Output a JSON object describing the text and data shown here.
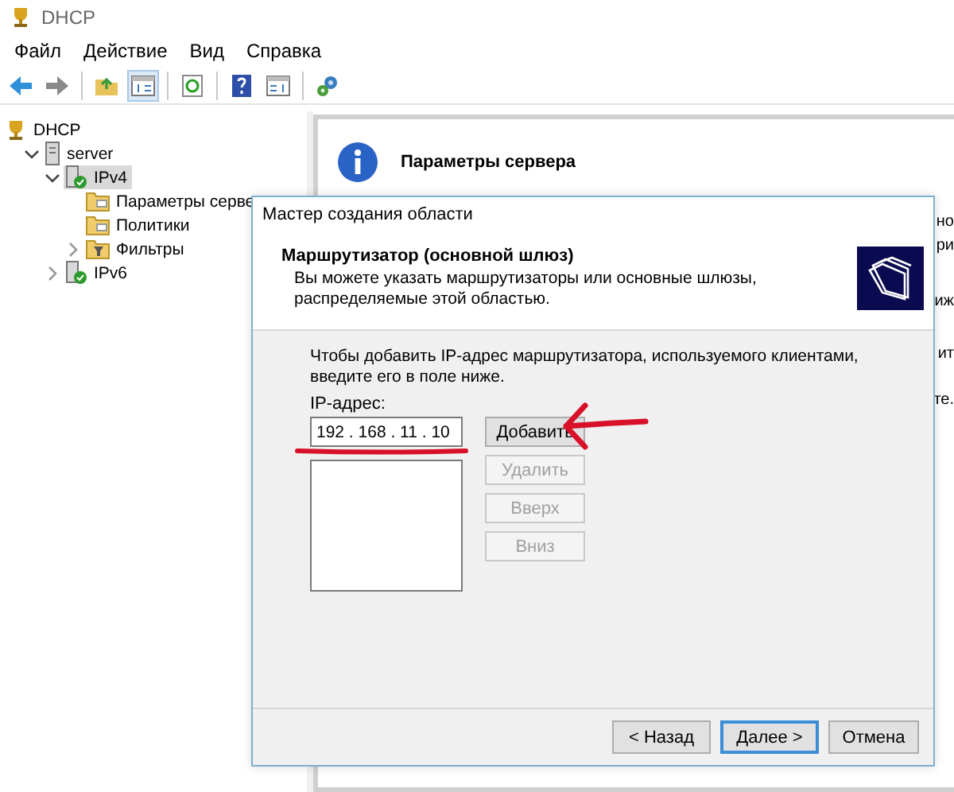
{
  "window": {
    "title": "DHCP"
  },
  "menu": [
    "Файл",
    "Действие",
    "Вид",
    "Справка"
  ],
  "toolbar": [
    {
      "kind": "back",
      "pressed": false
    },
    {
      "kind": "forward",
      "pressed": false
    },
    {
      "kind": "separator"
    },
    {
      "kind": "up",
      "pressed": false
    },
    {
      "kind": "tree",
      "pressed": true
    },
    {
      "kind": "separator"
    },
    {
      "kind": "refresh",
      "pressed": false
    },
    {
      "kind": "separator"
    },
    {
      "kind": "help",
      "pressed": false
    },
    {
      "kind": "panel",
      "pressed": false
    },
    {
      "kind": "separator"
    },
    {
      "kind": "gears",
      "pressed": false
    }
  ],
  "tree": [
    {
      "label": "DHCP",
      "kind": "root",
      "selected": false,
      "children": [
        {
          "label": "server",
          "kind": "server",
          "expanded": true,
          "selected": false,
          "children": [
            {
              "label": "IPv4",
              "kind": "protocol",
              "expanded": true,
              "selected": true,
              "children": [
                {
                  "label": "Параметры серве",
                  "kind": "folder",
                  "selected": false
                },
                {
                  "label": "Политики",
                  "kind": "folder",
                  "selected": false
                },
                {
                  "label": "Фильтры",
                  "kind": "filter",
                  "expanded": false,
                  "selected": false
                }
              ]
            },
            {
              "label": "IPv6",
              "kind": "protocol",
              "expanded": false,
              "selected": false
            }
          ]
        }
      ]
    }
  ],
  "details": {
    "title": "Параметры сервера",
    "fragments": [
      "но",
      "ри",
      "иж",
      "ит",
      "те."
    ]
  },
  "dialog": {
    "title": "Мастер создания области",
    "heading": "Маршрутизатор (основной шлюз)",
    "subheading": "Вы можете указать маршрутизаторы или основные шлюзы, распределяемые этой областью.",
    "instructions": "Чтобы добавить IP-адрес маршрутизатора, используемого клиентами, введите его в поле ниже.",
    "ip_label": "IP-адрес:",
    "ip_address": "192 . 168 . 11 . 10",
    "side_buttons": [
      {
        "label": "Добавить",
        "disabled": false
      },
      {
        "label": "Удалить",
        "disabled": true
      },
      {
        "label": "Вверх",
        "disabled": true
      },
      {
        "label": "Вниз",
        "disabled": true
      }
    ],
    "footer_buttons": [
      {
        "label": "< Назад",
        "default": false
      },
      {
        "label": "Далее >",
        "default": true
      },
      {
        "label": "Отмена",
        "default": false
      }
    ]
  }
}
